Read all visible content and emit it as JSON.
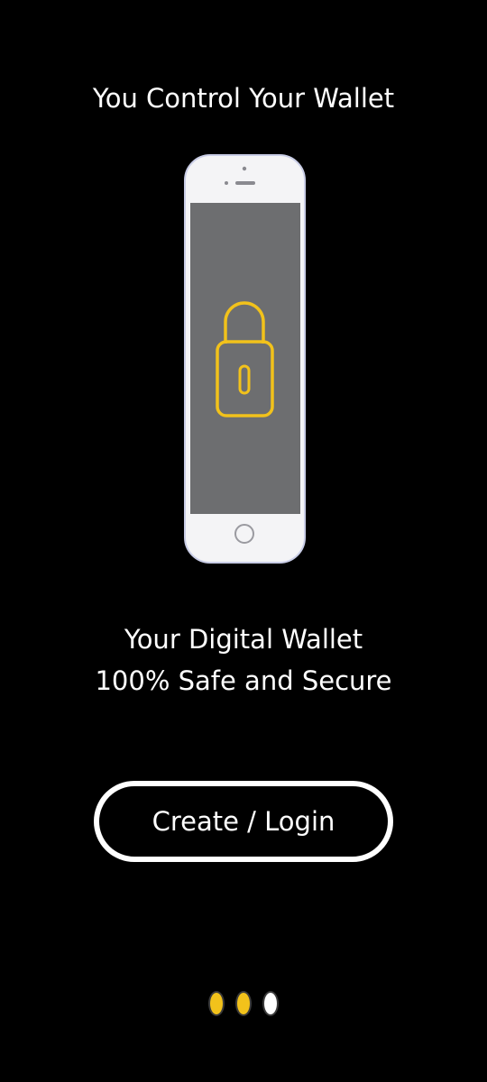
{
  "screen": {
    "title": "You Control Your Wallet",
    "tagline_line1": "Your Digital Wallet",
    "tagline_line2": "100% Safe and Secure"
  },
  "illustration": {
    "icon": "phone-lock-icon",
    "lock_color": "#f2c21b",
    "screen_color": "#6d6e70",
    "phone_color": "#f4f4f6"
  },
  "cta": {
    "label": "Create / Login"
  },
  "pager": {
    "total": 3,
    "current": 3,
    "active_color": "#f2c21b",
    "inactive_color": "#ffffff"
  }
}
